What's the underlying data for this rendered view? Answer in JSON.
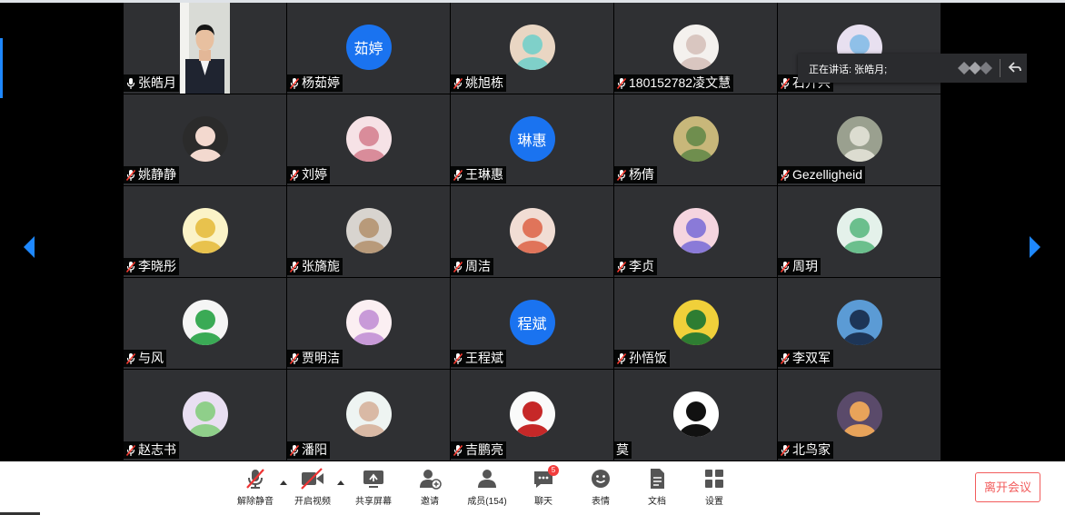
{
  "speaking": {
    "label": "正在讲话: 张皓月;"
  },
  "participants": [
    {
      "name": "张皓月",
      "type": "video",
      "muted": false
    },
    {
      "name": "杨茹婷",
      "type": "text",
      "initials": "茹婷",
      "muted": true
    },
    {
      "name": "姚旭栋",
      "type": "photo",
      "muted": true
    },
    {
      "name": "180152782凌文慧",
      "type": "photo",
      "muted": true
    },
    {
      "name": "石开兴",
      "type": "photo",
      "muted": true
    },
    {
      "name": "姚静静",
      "type": "photo",
      "muted": true
    },
    {
      "name": "刘婷",
      "type": "photo",
      "muted": true
    },
    {
      "name": "王琳惠",
      "type": "text",
      "initials": "琳惠",
      "muted": true
    },
    {
      "name": "杨倩",
      "type": "photo",
      "muted": true
    },
    {
      "name": "Gezelligheid",
      "type": "photo",
      "muted": true
    },
    {
      "name": "李晓彤",
      "type": "photo",
      "muted": true
    },
    {
      "name": "张旖旎",
      "type": "photo",
      "muted": true
    },
    {
      "name": "周洁",
      "type": "photo",
      "muted": true
    },
    {
      "name": "李贞",
      "type": "photo",
      "muted": true
    },
    {
      "name": "周玥",
      "type": "photo",
      "muted": true
    },
    {
      "name": "与风",
      "type": "photo",
      "muted": true
    },
    {
      "name": "贾明洁",
      "type": "photo",
      "muted": true
    },
    {
      "name": "王程斌",
      "type": "text",
      "initials": "程斌",
      "muted": true
    },
    {
      "name": "孙悟饭",
      "type": "photo",
      "muted": true
    },
    {
      "name": "李双军",
      "type": "photo",
      "muted": true
    },
    {
      "name": "赵志书",
      "type": "photo",
      "muted": true
    },
    {
      "name": "潘阳",
      "type": "photo",
      "muted": true
    },
    {
      "name": "吉鹏亮",
      "type": "photo",
      "muted": true
    },
    {
      "name": "莫",
      "type": "photo",
      "muted": false
    },
    {
      "name": "北鸟家",
      "type": "photo",
      "muted": true
    }
  ],
  "toolbar": {
    "unmute": "解除静音",
    "start_video": "开启视频",
    "share_screen": "共享屏幕",
    "invite": "邀请",
    "members": "成员(154)",
    "chat": "聊天",
    "chat_badge": "5",
    "reactions": "表情",
    "documents": "文档",
    "settings": "设置",
    "leave": "离开会议"
  },
  "colors": {
    "accent": "#1e88ff",
    "tile_bg": "#2f3033",
    "leave": "#f25c5c",
    "badge": "#f23c3c",
    "text_avatar": "#1a73f0"
  }
}
